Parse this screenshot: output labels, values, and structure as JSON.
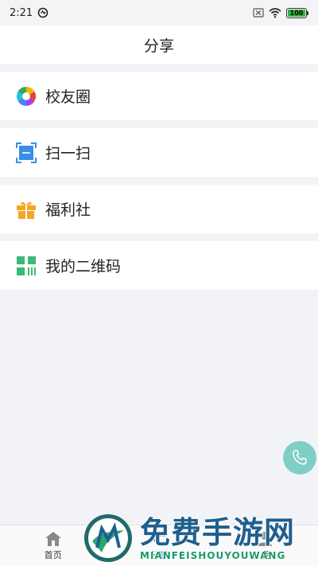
{
  "status_bar": {
    "time": "2:21",
    "icons": [
      "sync-icon",
      "sim-off-icon",
      "wifi-icon",
      "battery-icon"
    ],
    "battery": "100"
  },
  "header": {
    "title": "分享"
  },
  "menu": {
    "items": [
      {
        "label": "校友圈",
        "icon": "aperture-icon"
      },
      {
        "label": "扫一扫",
        "icon": "scan-icon"
      },
      {
        "label": "福利社",
        "icon": "gift-icon"
      },
      {
        "label": "我的二维码",
        "icon": "qrcode-icon"
      }
    ]
  },
  "fab": {
    "icon": "phone-icon",
    "color": "#7fcfc7"
  },
  "tabs": [
    {
      "label": "首页",
      "icon": "home-icon",
      "active": false
    },
    {
      "label": "分享",
      "icon": "share-icon",
      "active": true
    },
    {
      "label": "我",
      "icon": "user-icon",
      "active": false
    }
  ],
  "watermark": {
    "title": "免费手游网",
    "subtitle": "MIANFEISHOUYOUWANG"
  },
  "colors": {
    "accent": "#3a8ee6",
    "background": "#f2f3f7",
    "fab": "#7fcfc7"
  }
}
